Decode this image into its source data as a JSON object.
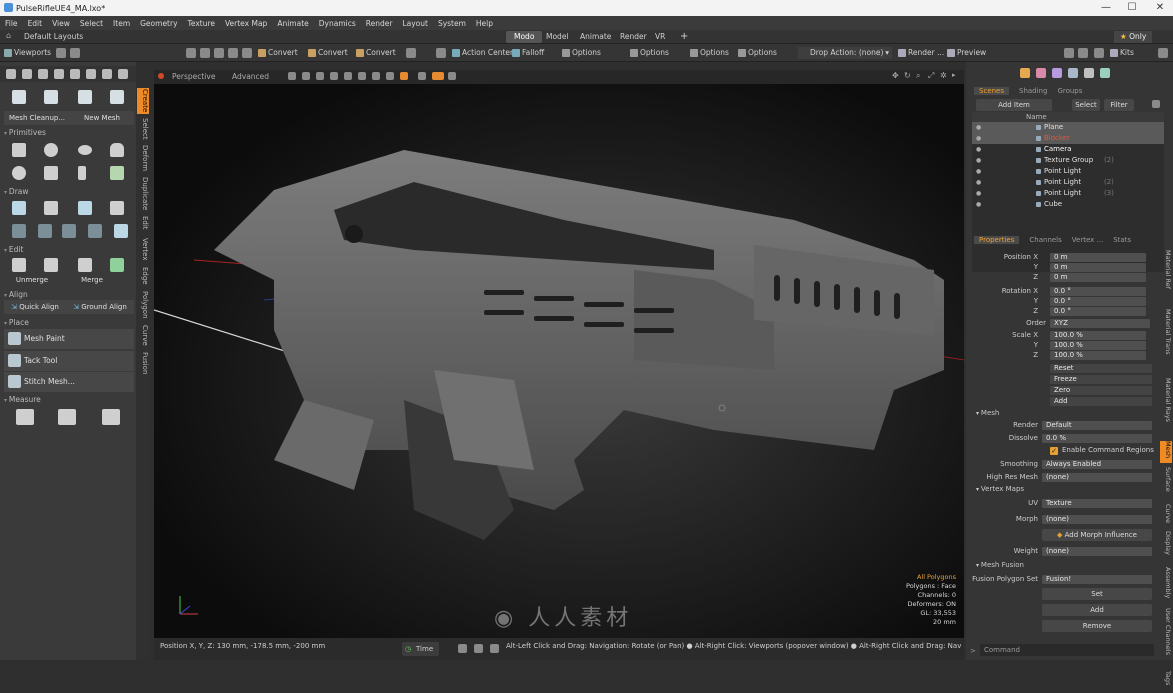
{
  "title": "PulseRifleUE4_MA.lxo*",
  "menu": [
    "File",
    "Edit",
    "View",
    "Select",
    "Item",
    "Geometry",
    "Texture",
    "Vertex Map",
    "Animate",
    "Dynamics",
    "Render",
    "Layout",
    "System",
    "Help"
  ],
  "layout": {
    "name": "Default Layouts",
    "tabs": [
      "Modo",
      "Model",
      "Animate",
      "Render",
      "VR"
    ],
    "plus": "+",
    "only": "Only"
  },
  "toolbar": {
    "viewports": "Viewports",
    "convert1": "Convert",
    "convert2": "Convert",
    "convert3": "Convert",
    "action_center": "Action Center",
    "falloff": "Falloff",
    "options1": "Options",
    "options2": "Options",
    "options3": "Options",
    "options4": "Options",
    "drop_action": "Drop Action: (none)",
    "render": "Render ...",
    "preview": "Preview",
    "kits": "Kits"
  },
  "left": {
    "mesh_cleanup": "Mesh Cleanup...",
    "new_mesh": "New Mesh",
    "primitives": "Primitives",
    "draw": "Draw",
    "edit": "Edit",
    "unmerge": "Unmerge",
    "merge": "Merge",
    "align": "Align",
    "quick_align": "Quick Align",
    "ground_align": "Ground Align",
    "place": "Place",
    "mesh_paint": "Mesh Paint",
    "tack_tool": "Tack Tool",
    "stitch_mesh": "Stitch Mesh...",
    "measure": "Measure"
  },
  "vtabs": [
    "Create",
    "Select",
    "Deform",
    "Duplicate",
    "Edit",
    "Vertex",
    "Edge",
    "Polygon",
    "Curve",
    "Fusion"
  ],
  "viewport": {
    "perspective": "Perspective",
    "advanced": "Advanced",
    "info": [
      "All Polygons",
      "Polygons : Face",
      "Channels: 0",
      "Deformers: ON",
      "GL: 33,553",
      "20 mm"
    ]
  },
  "status": {
    "position": "Position X, Y, Z:  130 mm, -178.5 mm, -200 mm",
    "time": "Time",
    "hint": "Alt-Left Click and Drag: Navigation: Rotate (or Pan) ● Alt-Right Click: Viewports (popover window) ● Alt-Right Click and Drag: Navigation: Freewheel ●"
  },
  "scene": {
    "tabs": [
      "Scenes",
      "Shading",
      "Groups"
    ],
    "add_item": "Add Item",
    "select": "Select",
    "filter": "Filter",
    "name_col": "Name",
    "items": [
      {
        "name": "Plane",
        "color": "#e0e0e0",
        "selected": true
      },
      {
        "name": "Blocker",
        "color": "#e05a3a",
        "selected": true
      },
      {
        "name": "Camera",
        "color": "#ffffff",
        "selected": false
      },
      {
        "name": "Texture Group",
        "count": "(2)",
        "color": "#e0e0e0",
        "selected": false
      },
      {
        "name": "Point Light",
        "color": "#e0e0e0",
        "selected": false
      },
      {
        "name": "Point Light",
        "count": "(2)",
        "color": "#e0e0e0",
        "selected": false
      },
      {
        "name": "Point Light",
        "count": "(3)",
        "color": "#e0e0e0",
        "selected": false
      },
      {
        "name": "Cube",
        "color": "#e0e0e0",
        "selected": false
      }
    ]
  },
  "props": {
    "tabs": [
      "Properties",
      "Channels",
      "Vertex ...",
      "Stats"
    ],
    "position_label": "Position X",
    "rotation_label": "Rotation X",
    "scale_label": "Scale X",
    "y": "Y",
    "z": "Z",
    "position": [
      "0 m",
      "0 m",
      "0 m"
    ],
    "rotation": [
      "0.0 °",
      "0.0 °",
      "0.0 °"
    ],
    "scale": [
      "100.0 %",
      "100.0 %",
      "100.0 %"
    ],
    "order_label": "Order",
    "order": "XYZ",
    "reset": "Reset",
    "freeze": "Freeze",
    "zero": "Zero",
    "add": "Add",
    "mesh": "Mesh",
    "render_label": "Render",
    "render": "Default",
    "dissolve_label": "Dissolve",
    "dissolve": "0.0 %",
    "enable_cmd": "Enable Command Regions",
    "smoothing_label": "Smoothing",
    "smoothing": "Always Enabled",
    "highres_label": "High Res Mesh",
    "highres": "(none)",
    "vertex_maps": "Vertex Maps",
    "uv_label": "UV",
    "uv": "Texture",
    "morph_label": "Morph",
    "morph": "(none)",
    "add_morph": "Add Morph Influence",
    "weight_label": "Weight",
    "weight": "(none)",
    "mesh_fusion": "Mesh Fusion",
    "fusion_set_label": "Fusion Polygon Set",
    "fusion_set": "Fusion!",
    "set": "Set",
    "add2": "Add",
    "remove": "Remove"
  },
  "rvtabs": [
    "Material Ref",
    "Material Trans",
    "Material Rays",
    "Mesh",
    "Surface",
    "Curve",
    "Display",
    "Assembly",
    "User Channels",
    "Tags"
  ],
  "command": "Command",
  "watermark": "人人素材"
}
